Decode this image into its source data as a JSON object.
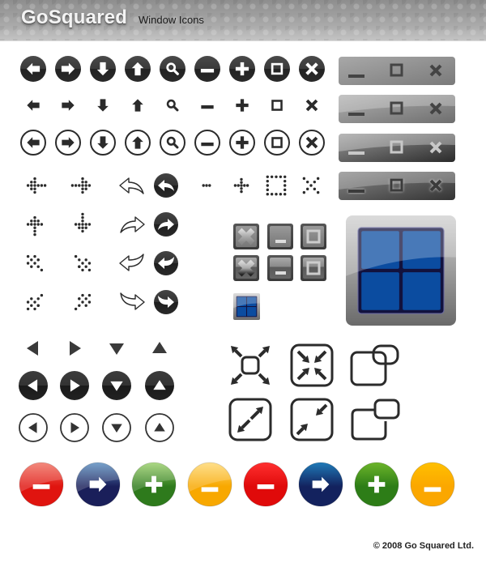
{
  "header": {
    "brand": "GoSquared",
    "subtitle": "Window Icons"
  },
  "icon_rows": [
    {
      "style": "solid-circle",
      "icons": [
        "arrow-left",
        "arrow-right",
        "arrow-down",
        "arrow-up",
        "search",
        "minus",
        "plus",
        "maximize",
        "close"
      ]
    },
    {
      "style": "plain",
      "icons": [
        "arrow-left",
        "arrow-right",
        "arrow-down",
        "arrow-up",
        "search",
        "minus",
        "plus",
        "maximize",
        "close"
      ]
    },
    {
      "style": "outline-circle",
      "icons": [
        "arrow-left",
        "arrow-right",
        "arrow-down",
        "arrow-up",
        "search",
        "minus",
        "plus",
        "maximize",
        "close"
      ]
    }
  ],
  "window_bars": [
    {
      "variant": "flat-grey",
      "buttons": [
        "minimize",
        "maximize",
        "close"
      ]
    },
    {
      "variant": "glossy-grey",
      "buttons": [
        "minimize",
        "maximize",
        "close"
      ]
    },
    {
      "variant": "glossy-dark",
      "buttons": [
        "minimize",
        "maximize",
        "close"
      ]
    },
    {
      "variant": "glossy-dark-glow",
      "buttons": [
        "minimize",
        "maximize",
        "close"
      ]
    }
  ],
  "dotted_icons": [
    [
      "dotted-arrow-left",
      "dotted-arrow-right",
      "outline-curved-arrow-back",
      "solid-curved-arrow-back"
    ],
    [
      "dotted-arrow-up",
      "dotted-arrow-down",
      "outline-curved-arrow-forward",
      "solid-curved-arrow-forward"
    ],
    [
      "dotted-arrow-up-left",
      "dotted-arrow-down-right",
      "outline-curved-arrow-back-alt",
      "solid-curved-arrow-back-alt"
    ],
    [
      "dotted-arrow-down-left",
      "dotted-arrow-up-right",
      "outline-curved-arrow-forward-alt",
      "solid-curved-arrow-forward-alt"
    ]
  ],
  "dotted_window_icons": [
    "dotted-minimize",
    "dotted-plus",
    "dotted-square",
    "dotted-close"
  ],
  "square_buttons": [
    [
      "close",
      "minimize",
      "maximize"
    ],
    [
      "close",
      "minimize",
      "maximize"
    ]
  ],
  "windows_icon_small": "windows-logo-small",
  "windows_icon_large": "windows-logo-large",
  "triangle_rows": [
    {
      "style": "plain",
      "icons": [
        "triangle-left",
        "triangle-right",
        "triangle-down",
        "triangle-up"
      ]
    },
    {
      "style": "solid-circle",
      "icons": [
        "triangle-left",
        "triangle-right",
        "triangle-down",
        "triangle-up"
      ]
    },
    {
      "style": "outline-circle",
      "icons": [
        "triangle-left",
        "triangle-right",
        "triangle-down",
        "triangle-up"
      ]
    }
  ],
  "resize_icons": [
    [
      "expand-arrows",
      "collapse-arrows-boxed",
      "restore-windows-overlap"
    ],
    [
      "expand-diagonal-boxed",
      "collapse-diagonal-boxed",
      "restore-windows-offset"
    ]
  ],
  "color_buttons": [
    {
      "icon": "minus",
      "color": "#e0140f",
      "highlight": "#f07060"
    },
    {
      "icon": "arrow-right",
      "color": "#1a1f5a",
      "highlight": "#5a8ec0"
    },
    {
      "icon": "plus",
      "color": "#2e7a1c",
      "highlight": "#9ad06a"
    },
    {
      "icon": "minus-low",
      "color": "#f8a800",
      "highlight": "#ffd870"
    },
    {
      "icon": "minus",
      "color": "#e00a0a",
      "highlight": "#ff3030"
    },
    {
      "icon": "arrow-right",
      "color": "#13225e",
      "highlight": "#1f7ab8"
    },
    {
      "icon": "plus",
      "color": "#2d7d17",
      "highlight": "#6cb52a"
    },
    {
      "icon": "minus-low",
      "color": "#fba700",
      "highlight": "#ffc000"
    }
  ],
  "footer": {
    "copyright": "© 2008 Go Squared Ltd."
  }
}
